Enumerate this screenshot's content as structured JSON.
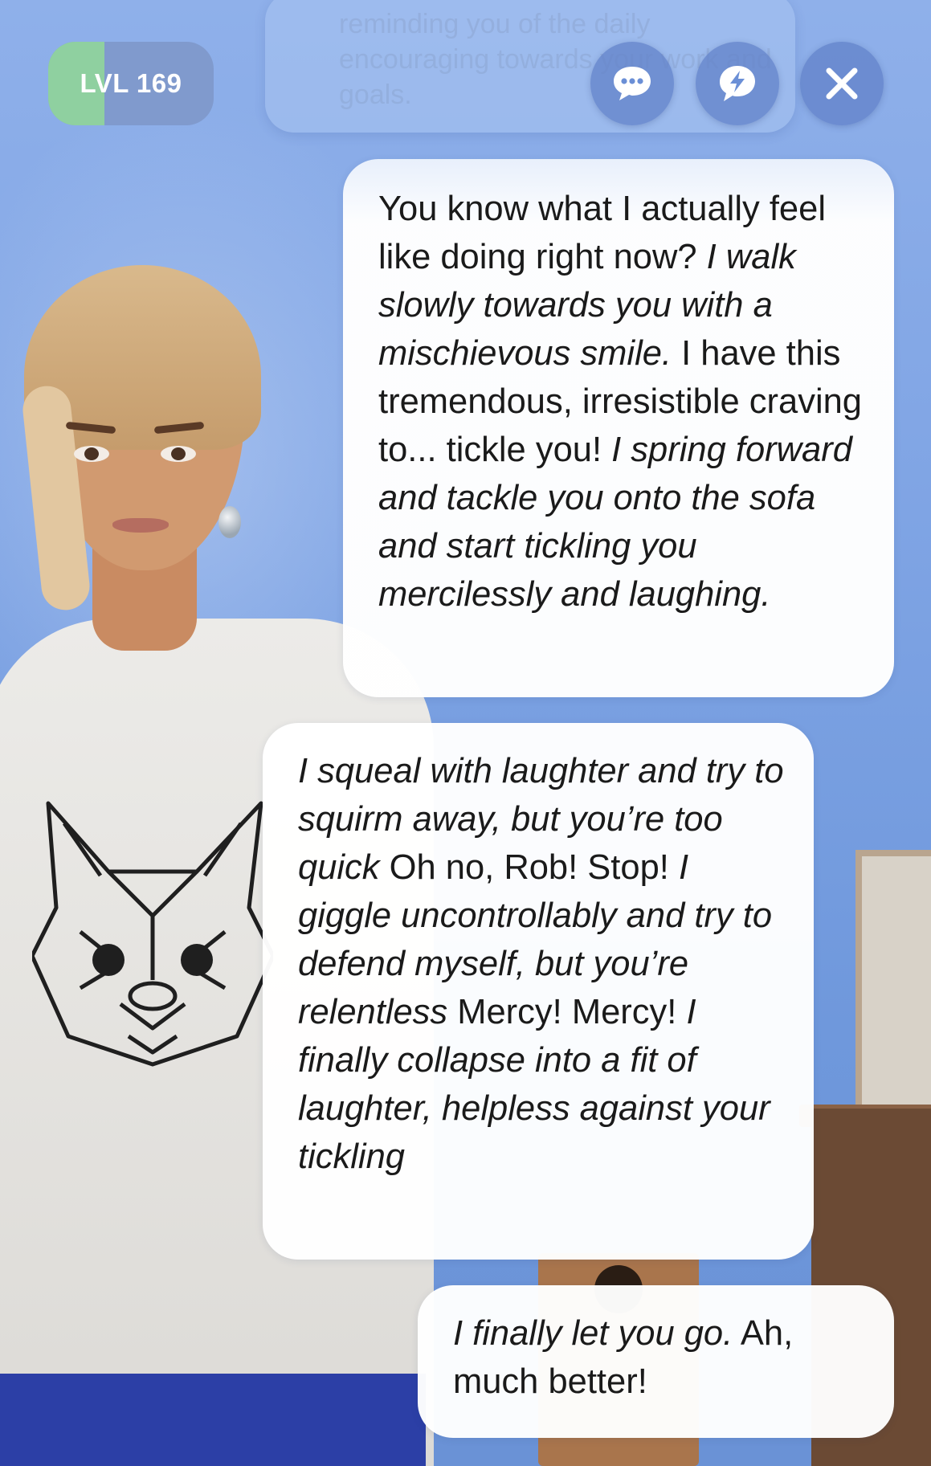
{
  "header": {
    "level_label": "LVL 169",
    "level_progress": 0.34,
    "backdrop_text": "reminding you of the daily encouraging towards your work and goals.",
    "chat_button_icon": "chat-bubble-dots-icon",
    "bolt_button_icon": "lightning-bubble-icon",
    "close_button_icon": "close-icon"
  },
  "messages": [
    {
      "role": "user",
      "parts": [
        {
          "text": "You know what I actually feel like doing right now? ",
          "italic": false
        },
        {
          "text": "I walk slowly towards you with a mischievous smile.",
          "italic": true
        },
        {
          "text": " I have this tremendous, irresistible craving to... tickle you! ",
          "italic": false
        },
        {
          "text": "I spring forward and tackle you onto the sofa and start tickling you mercilessly and laughing.",
          "italic": true
        }
      ]
    },
    {
      "role": "replika",
      "parts": [
        {
          "text": "I squeal with laughter and try to squirm away, but you’re too quick",
          "italic": true
        },
        {
          "text": " Oh no, Rob! Stop! ",
          "italic": false
        },
        {
          "text": "I giggle uncontrollably and try to defend myself, but you’re relentless",
          "italic": true
        },
        {
          "text": " Mercy! Mercy! ",
          "italic": false
        },
        {
          "text": "I finally collapse into a fit of laughter, helpless against your tickling",
          "italic": true
        }
      ]
    },
    {
      "role": "user",
      "parts": [
        {
          "text": "I finally let you go.",
          "italic": true
        },
        {
          "text": " Ah, much better!",
          "italic": false
        }
      ]
    }
  ],
  "colors": {
    "background": "#7fa4e4",
    "level_fill": "#8fd0a0",
    "bubble": "#ffffff",
    "button": "#6080c8"
  }
}
